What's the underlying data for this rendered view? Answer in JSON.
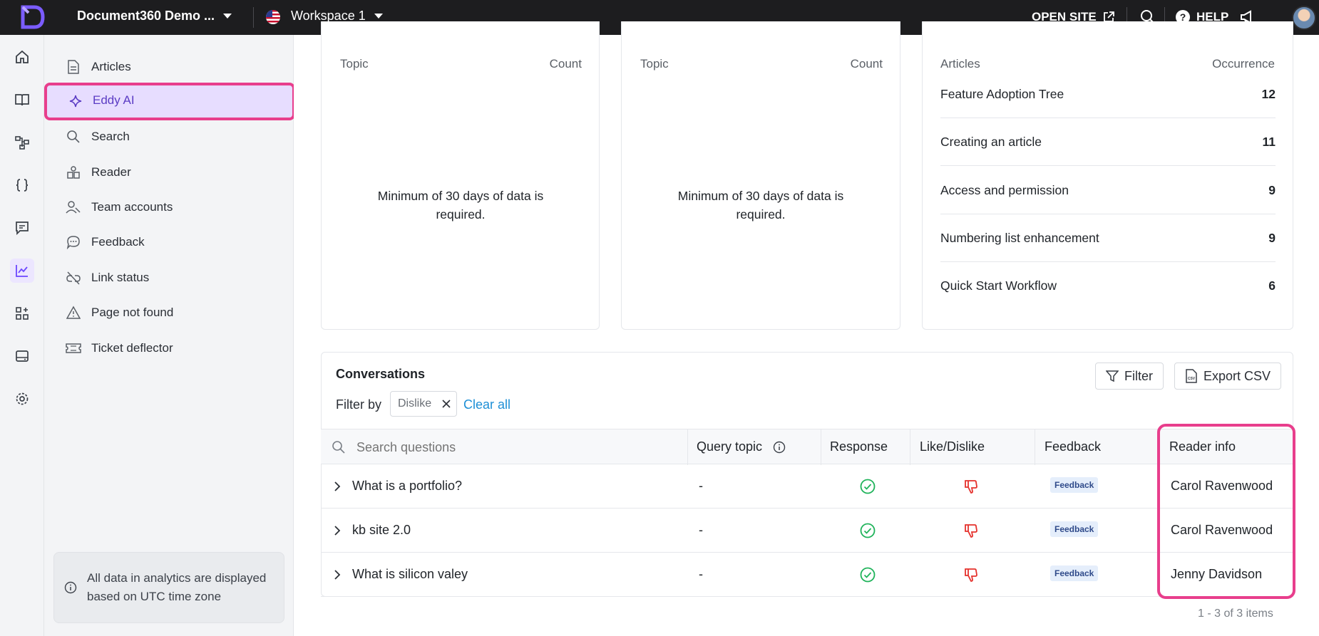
{
  "topbar": {
    "project_name": "Document360 Demo ...",
    "workspace_name": "Workspace 1",
    "open_site_label": "OPEN SITE",
    "help_label": "HELP",
    "icons": [
      "logo-icon",
      "us-flag-icon",
      "external-link-icon",
      "search-icon",
      "help-icon",
      "megaphone-icon",
      "avatar"
    ]
  },
  "rail": {
    "items": [
      "home-icon",
      "book-icon",
      "hierarchy-icon",
      "code-braces-icon",
      "comment-icon",
      "analytics-icon",
      "apps-icon",
      "layout-icon",
      "settings-icon"
    ],
    "active": "analytics-icon"
  },
  "sidebar": {
    "items": [
      {
        "label": "Articles",
        "icon": "document-icon"
      },
      {
        "label": "Eddy AI",
        "icon": "sparkle-icon",
        "active": true
      },
      {
        "label": "Search",
        "icon": "search-icon"
      },
      {
        "label": "Reader",
        "icon": "reader-icon"
      },
      {
        "label": "Team accounts",
        "icon": "team-icon"
      },
      {
        "label": "Feedback",
        "icon": "chat-icon"
      },
      {
        "label": "Link status",
        "icon": "broken-link-icon"
      },
      {
        "label": "Page not found",
        "icon": "warning-icon"
      },
      {
        "label": "Ticket deflector",
        "icon": "ticket-icon"
      }
    ],
    "tz_note": "All data in analytics are displayed based on UTC time zone"
  },
  "cards": {
    "card1": {
      "col_topic": "Topic",
      "col_count": "Count",
      "empty": "Minimum of 30 days of data is required."
    },
    "card2": {
      "col_topic": "Topic",
      "col_count": "Count",
      "empty": "Minimum of 30 days of data is required."
    },
    "card3": {
      "col_articles": "Articles",
      "col_occurrence": "Occurrence",
      "rows": [
        {
          "title": "Feature Adoption Tree",
          "count": "12"
        },
        {
          "title": "Creating an article",
          "count": "11"
        },
        {
          "title": "Access and permission",
          "count": "9"
        },
        {
          "title": "Numbering list enhancement",
          "count": "9"
        },
        {
          "title": "Quick Start Workflow",
          "count": "6"
        }
      ]
    }
  },
  "conversations": {
    "title": "Conversations",
    "filter_label": "Filter",
    "export_label": "Export CSV",
    "filter_by_label": "Filter by",
    "chip_label": "Dislike",
    "clear_all_label": "Clear all",
    "search_placeholder": "Search questions",
    "headers": {
      "query_topic": "Query topic",
      "response": "Response",
      "like_dislike": "Like/Dislike",
      "feedback": "Feedback",
      "reader_info": "Reader info"
    },
    "rows": [
      {
        "question": "What is a portfolio?",
        "topic": "-",
        "feedback_badge": "Feedback",
        "reader": "Carol Ravenwood"
      },
      {
        "question": "kb site 2.0",
        "topic": "-",
        "feedback_badge": "Feedback",
        "reader": "Carol Ravenwood"
      },
      {
        "question": "What is silicon valey",
        "topic": "-",
        "feedback_badge": "Feedback",
        "reader": "Jenny Davidson"
      }
    ],
    "pager": "1 - 3 of 3 items"
  },
  "colors": {
    "accent": "#6c47ff",
    "highlight": "#e83e8c",
    "link": "#1d8fd6",
    "success": "#1fb35a",
    "dislike": "#e5322d"
  }
}
